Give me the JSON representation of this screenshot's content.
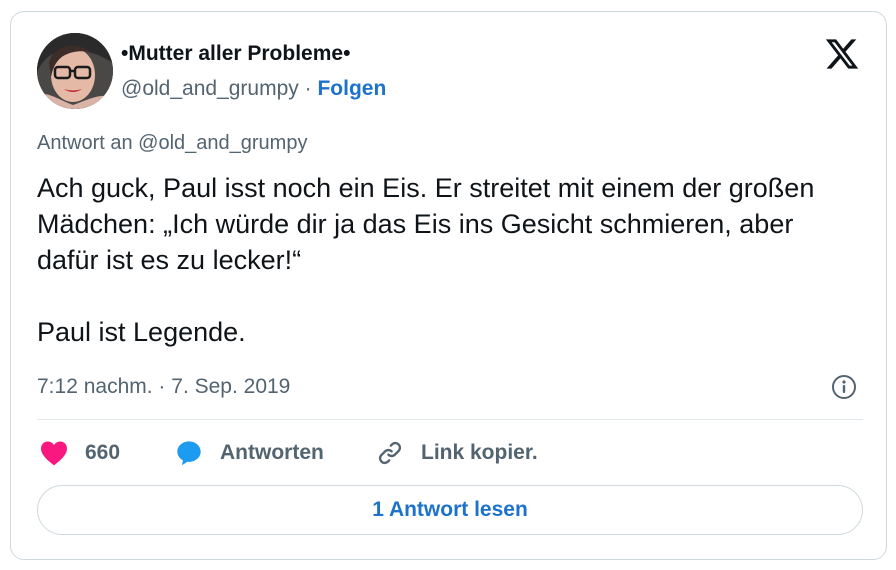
{
  "author": {
    "display_name": "•Mutter aller Probleme•",
    "handle": "@old_and_grumpy",
    "separator": "·",
    "follow_label": "Folgen"
  },
  "platform_logo": "x-logo",
  "reply_to": "Antwort an @old_and_grumpy",
  "tweet": {
    "paragraph_1": "Ach guck, Paul isst noch ein Eis. Er streitet mit einem der großen Mädchen: „Ich würde dir ja das Eis ins Gesicht schmieren, aber dafür ist es zu lecker!“",
    "paragraph_2": "Paul ist Legende."
  },
  "timestamp": {
    "time": "7:12 nachm.",
    "separator": "·",
    "date": "7. Sep. 2019"
  },
  "actions": {
    "likes_count": "660",
    "reply_label": "Antworten",
    "copy_link_label": "Link kopier."
  },
  "read_replies_label": "1 Antwort lesen",
  "colors": {
    "heart": "#f91880",
    "reply_icon": "#1d9bf0",
    "link_blue": "#1d72c9",
    "secondary_text": "#536471",
    "border": "#cfd9de"
  }
}
